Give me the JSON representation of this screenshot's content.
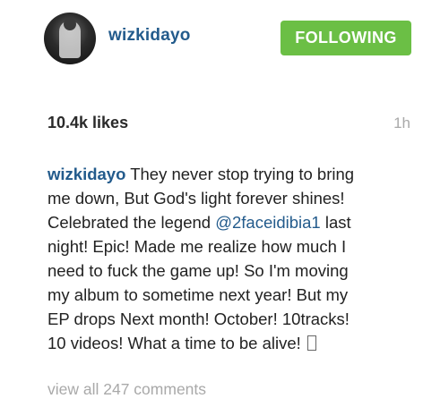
{
  "post": {
    "username": "wizkidayo",
    "follow_label": "FOLLOWING",
    "likes": "10.4k likes",
    "time": "1h",
    "caption": {
      "username": "wizkidayo",
      "text_part1": " They never stop trying to bring me down, But God's light forever shines! Celebrated the legend ",
      "mention": "@2faceidibia1",
      "text_part2": " last night! Epic! Made me realize how much I need to fuck the game up! So I'm moving my album to sometime next year! But my EP drops Next month! October! 10tracks! 10 videos! What a time to be alive! "
    },
    "view_comments": "view all 247 comments"
  },
  "colors": {
    "link_blue": "#235b8c",
    "follow_green": "#6bbf45",
    "muted_gray": "#a9a9a9"
  },
  "icons": {
    "avatar": "profile-photo",
    "unsupported_glyph": "missing-character-box"
  }
}
